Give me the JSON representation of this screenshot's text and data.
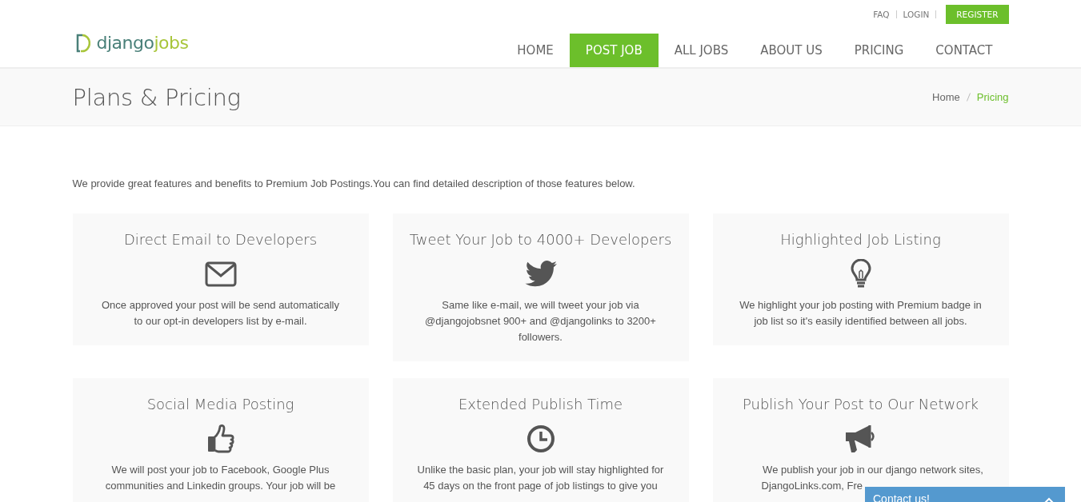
{
  "top_links": [
    {
      "label": "FAQ"
    },
    {
      "label": "LOGIN"
    }
  ],
  "register_button": "REGISTER",
  "logo": {
    "part_1": "django",
    "part_2": "jobs"
  },
  "nav": [
    {
      "label": "HOME",
      "selected": false
    },
    {
      "label": "POST JOB",
      "selected": true
    },
    {
      "label": "ALL JOBS",
      "selected": false
    },
    {
      "label": "ABOUT US",
      "selected": false
    },
    {
      "label": "PRICING",
      "selected": false
    },
    {
      "label": "CONTACT",
      "selected": false
    }
  ],
  "page_title": "Plans & Pricing",
  "breadcrumb": [
    {
      "label": "Home",
      "current": false
    },
    {
      "label": "Pricing",
      "current": true
    }
  ],
  "intro": "We provide great features and benefits to Premium Job Postings.You can find detailed description of those features below.",
  "features": [
    {
      "title": "Direct Email to Developers",
      "text": "Once approved your post will be send automatically to our opt-in developers list by e-mail."
    },
    {
      "title": "Tweet Your Job to 4000+ Developers",
      "text": "Same like e-mail, we will tweet your job via @djangojobsnet 900+ and @djangolinks to 3200+ followers."
    },
    {
      "title": "Highlighted Job Listing",
      "text": "We highlight your job posting with Premium badge in job list so it's easily identified between all jobs."
    },
    {
      "title": "Social Media Posting",
      "text": "We will post your job to Facebook, Google Plus communities and Linkedin groups. Your job will be"
    },
    {
      "title": "Extended Publish Time",
      "text": "Unlike the basic plan, your job will stay highlighted for 45 days on the front page of job listings to give you"
    },
    {
      "title": "Publish Your Post to Our Network",
      "text": "We publish your job in our django network sites, DjangoLinks.com, Fre"
    }
  ],
  "contact_widget": {
    "label": "Contact us!"
  }
}
